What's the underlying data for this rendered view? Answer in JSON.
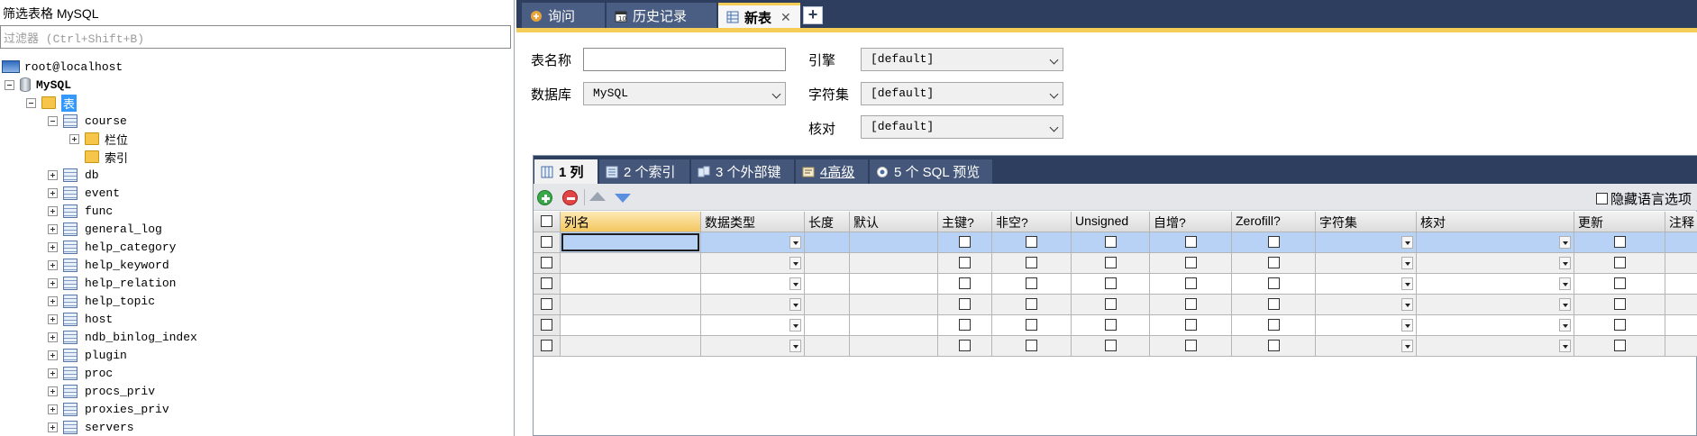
{
  "left_pane": {
    "title": "筛选表格 MySQL",
    "filter_placeholder": "过滤器 (Ctrl+Shift+B)",
    "server": "root@localhost",
    "database": "MySQL",
    "tables_node": "表",
    "expanded_table": "course",
    "expanded_children": [
      "栏位",
      "索引"
    ],
    "tables": [
      "db",
      "event",
      "func",
      "general_log",
      "help_category",
      "help_keyword",
      "help_relation",
      "help_topic",
      "host",
      "ndb_binlog_index",
      "plugin",
      "proc",
      "procs_priv",
      "proxies_priv",
      "servers"
    ]
  },
  "tabs": [
    {
      "label": "询问",
      "icon": "query-icon"
    },
    {
      "label": "历史记录",
      "icon": "history-icon"
    },
    {
      "label": "新表",
      "icon": "new-table-icon",
      "active": true
    }
  ],
  "form": {
    "table_name_label": "表名称",
    "table_name_value": "",
    "database_label": "数据库",
    "database_value": "MySQL",
    "engine_label": "引擎",
    "engine_value": "[default]",
    "charset_label": "字符集",
    "charset_value": "[default]",
    "collation_label": "核对",
    "collation_value": "[default]"
  },
  "sub_tabs": [
    {
      "label": "1 列",
      "active": true
    },
    {
      "label": "2 个索引"
    },
    {
      "label": "3 个外部键"
    },
    {
      "label": "4高级"
    },
    {
      "label": "5 个 SQL 预览"
    }
  ],
  "grid": {
    "hide_language_label": "隐藏语言选项",
    "columns": [
      "",
      "列名",
      "数据类型",
      "长度",
      "默认",
      "主键?",
      "非空?",
      "Unsigned",
      "自增?",
      "Zerofill?",
      "字符集",
      "核对",
      "更新",
      "注释"
    ],
    "row_count": 6
  },
  "colors": {
    "tab_bar": "#2d3e5e",
    "accent": "#f5cc56",
    "selection": "#3399ff",
    "current_row": "#b8d2f5"
  }
}
